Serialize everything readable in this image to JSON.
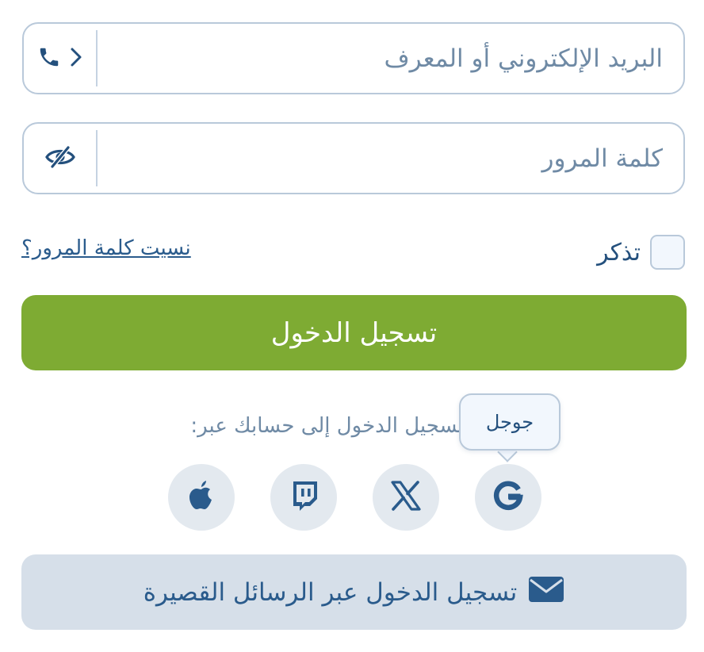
{
  "login_form": {
    "identifier_field": {
      "placeholder": "البريد الإلكتروني أو المعرف",
      "icons": [
        "phone-icon",
        "chevron-right-icon"
      ]
    },
    "password_field": {
      "placeholder": "كلمة المرور",
      "icons": [
        "eye-off-icon"
      ]
    },
    "remember_me": {
      "label": "تذكر",
      "checked": false
    },
    "forgot_password": "نسيت كلمة المرور؟",
    "submit_label": "تسجيل الدخول"
  },
  "social": {
    "caption": "تسجيل الدخول إلى حسابك عبر:",
    "tooltip": "جوجل",
    "providers": [
      {
        "name": "google",
        "icon": "google-icon"
      },
      {
        "name": "x",
        "icon": "x-icon"
      },
      {
        "name": "twitch",
        "icon": "twitch-icon"
      },
      {
        "name": "apple",
        "icon": "apple-icon"
      }
    ]
  },
  "sms": {
    "label": "تسجيل الدخول عبر الرسائل القصيرة",
    "icon": "envelope-icon"
  },
  "colors": {
    "primary": "#2a5b8c",
    "accent_green": "#7eab33",
    "border": "#b9c9da",
    "muted_text": "#6f8aa5"
  }
}
